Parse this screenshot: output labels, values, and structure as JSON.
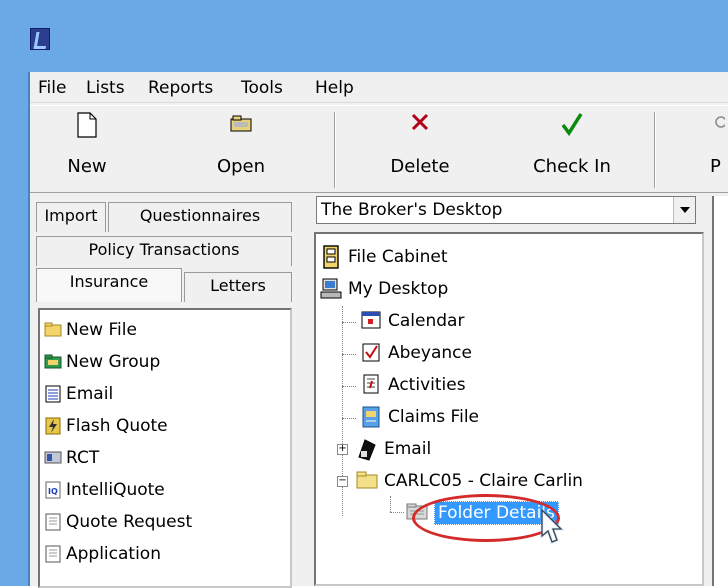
{
  "menu": {
    "file": "File",
    "lists": "Lists",
    "reports": "Reports",
    "tools": "Tools",
    "help": "Help"
  },
  "toolbar": {
    "new": "New",
    "open": "Open",
    "delete": "Delete",
    "check_in": "Check In",
    "partial_next": "P"
  },
  "left_tabs": {
    "import": "Import",
    "questionnaires": "Questionnaires",
    "policy_transactions": "Policy Transactions",
    "insurance": "Insurance",
    "letters": "Letters",
    "selected": "Insurance"
  },
  "left_list": [
    {
      "label": "New File",
      "icon": "folder-icon"
    },
    {
      "label": "New Group",
      "icon": "group-folder-icon"
    },
    {
      "label": "Email",
      "icon": "email-icon"
    },
    {
      "label": "Flash Quote",
      "icon": "flash-quote-icon"
    },
    {
      "label": "RCT",
      "icon": "rct-icon"
    },
    {
      "label": "IntelliQuote",
      "icon": "intelliquote-icon"
    },
    {
      "label": "Quote Request",
      "icon": "document-icon"
    },
    {
      "label": "Application",
      "icon": "document-icon"
    }
  ],
  "desktop_combo": {
    "value": "The Broker's Desktop"
  },
  "tree": [
    {
      "label": "File Cabinet",
      "icon": "file-cabinet-icon"
    },
    {
      "label": "My Desktop",
      "icon": "desktop-icon"
    },
    {
      "label": "Calendar",
      "icon": "calendar-icon"
    },
    {
      "label": "Abeyance",
      "icon": "abeyance-icon"
    },
    {
      "label": "Activities",
      "icon": "activities-icon"
    },
    {
      "label": "Claims File",
      "icon": "claims-icon"
    },
    {
      "label": "Email",
      "icon": "email-icon"
    },
    {
      "label": "CARLC05 - Claire Carlin",
      "icon": "folder-icon"
    },
    {
      "label": "Folder Details",
      "icon": "folder-details-icon"
    }
  ],
  "colors": {
    "titlebar": "#6aa8e6",
    "selection": "#3399ff",
    "highlight_oval": "#d42a2a"
  }
}
